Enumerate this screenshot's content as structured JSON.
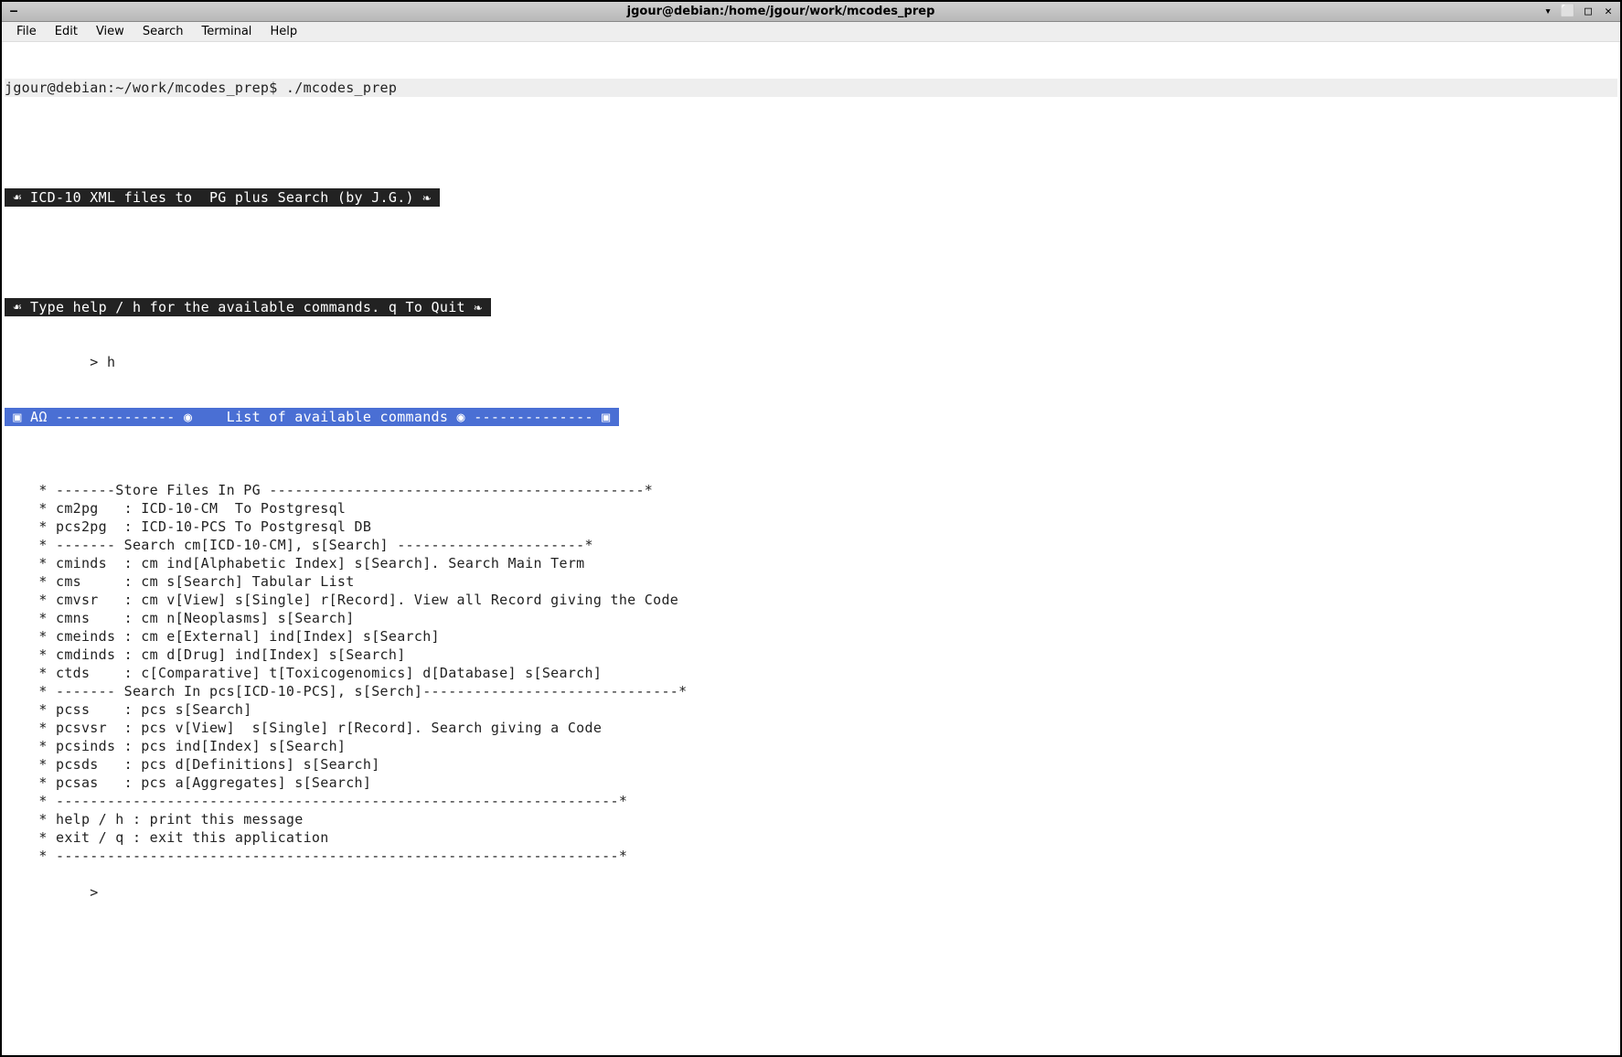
{
  "window": {
    "title": "jgour@debian:/home/jgour/work/mcodes_prep",
    "minimize_icon": "–",
    "collapse_icon": "▾",
    "restore_icon": "⬜",
    "maximize_icon": "□",
    "close_icon": "✕"
  },
  "menubar": {
    "file": "File",
    "edit": "Edit",
    "view": "View",
    "search": "Search",
    "terminal": "Terminal",
    "help": "Help"
  },
  "terminal": {
    "prompt": "jgour@debian:~/work/mcodes_prep$ ./mcodes_prep",
    "banner1": " ☙ ICD-10 XML files to  PG plus Search (by J.G.) ❧ ",
    "banner2": " ☙ Type help / h for the available commands. q To Quit ❧ ",
    "input_line": "          > h",
    "heading": " ▣ ΑΩ -------------- ◉    List of available commands ◉ -------------- ▣ ",
    "body_lines": [
      "",
      "    * -------Store Files In PG --------------------------------------------*",
      "    * cm2pg   : ICD-10-CM  To Postgresql",
      "    * pcs2pg  : ICD-10-PCS To Postgresql DB",
      "    * ------- Search cm[ICD-10-CM], s[Search] ----------------------*",
      "    * cminds  : cm ind[Alphabetic Index] s[Search]. Search Main Term",
      "    * cms     : cm s[Search] Tabular List",
      "    * cmvsr   : cm v[View] s[Single] r[Record]. View all Record giving the Code",
      "    * cmns    : cm n[Neoplasms] s[Search]",
      "    * cmeinds : cm e[External] ind[Index] s[Search]",
      "    * cmdinds : cm d[Drug] ind[Index] s[Search]",
      "    * ctds    : c[Comparative] t[Toxicogenomics] d[Database] s[Search]",
      "    * ------- Search In pcs[ICD-10-PCS], s[Serch]------------------------------*",
      "    * pcss    : pcs s[Search]",
      "    * pcsvsr  : pcs v[View]  s[Single] r[Record]. Search giving a Code",
      "    * pcsinds : pcs ind[Index] s[Search]",
      "    * pcsds   : pcs d[Definitions] s[Search]",
      "    * pcsas   : pcs a[Aggregates] s[Search]",
      "    * ------------------------------------------------------------------*",
      "    * help / h : print this message",
      "    * exit / q : exit this application",
      "    * ------------------------------------------------------------------*",
      "",
      "          > "
    ]
  }
}
